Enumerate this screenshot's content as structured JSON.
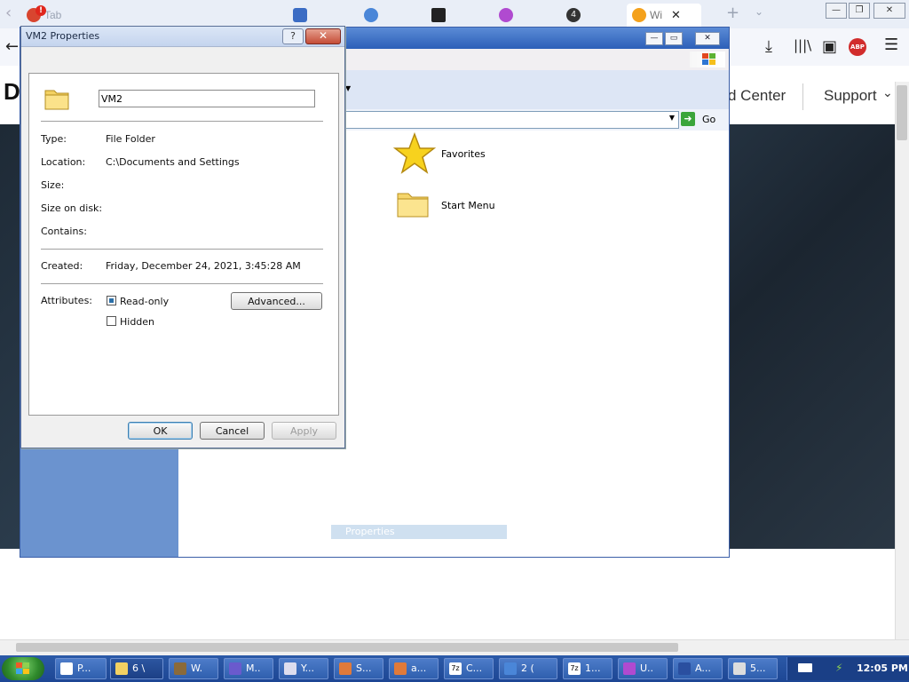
{
  "browser": {
    "tabs": [
      {
        "label": "Tab",
        "badge": "!"
      },
      {
        "label": "Wi"
      }
    ],
    "active_tab_close": "✕",
    "new_tab": "+",
    "site_nav": [
      "d Center",
      "Support"
    ],
    "site_logo_letter": "D"
  },
  "explorer": {
    "go_label": "Go",
    "items": [
      {
        "label": "Favorites",
        "icon": "star-icon"
      },
      {
        "label": "Start Menu",
        "icon": "folder-icon"
      }
    ],
    "status_text": "Properties"
  },
  "dialog": {
    "title": "VM2 Properties",
    "help_label": "?",
    "name_value": "VM2",
    "rows": [
      {
        "label": "Type:",
        "value": "File Folder"
      },
      {
        "label": "Location:",
        "value": "C:\\Documents and Settings"
      },
      {
        "label": "Size:",
        "value": ""
      },
      {
        "label": "Size on disk:",
        "value": ""
      },
      {
        "label": "Contains:",
        "value": ""
      }
    ],
    "created_label": "Created:",
    "created_value": "Friday, December 24, 2021, 3:45:28 AM",
    "attributes_label": "Attributes:",
    "readonly_label": "Read-only",
    "readonly_checked": true,
    "hidden_label": "Hidden",
    "hidden_checked": false,
    "advanced_label": "Advanced...",
    "ok_label": "OK",
    "cancel_label": "Cancel",
    "apply_label": "Apply"
  },
  "taskbar": {
    "buttons": [
      "P...",
      "6 \\",
      "W.",
      "M..",
      "Y...",
      "S...",
      "a...",
      "C...",
      "2 (",
      "1...",
      "U..",
      "A...",
      "5..."
    ],
    "clock": "12:05 PM"
  },
  "colors": {
    "taskbar_blue": "#2c5aa8",
    "explorer_left_pane": "#6b93cf",
    "dialog_bg": "#f0f0f0"
  }
}
